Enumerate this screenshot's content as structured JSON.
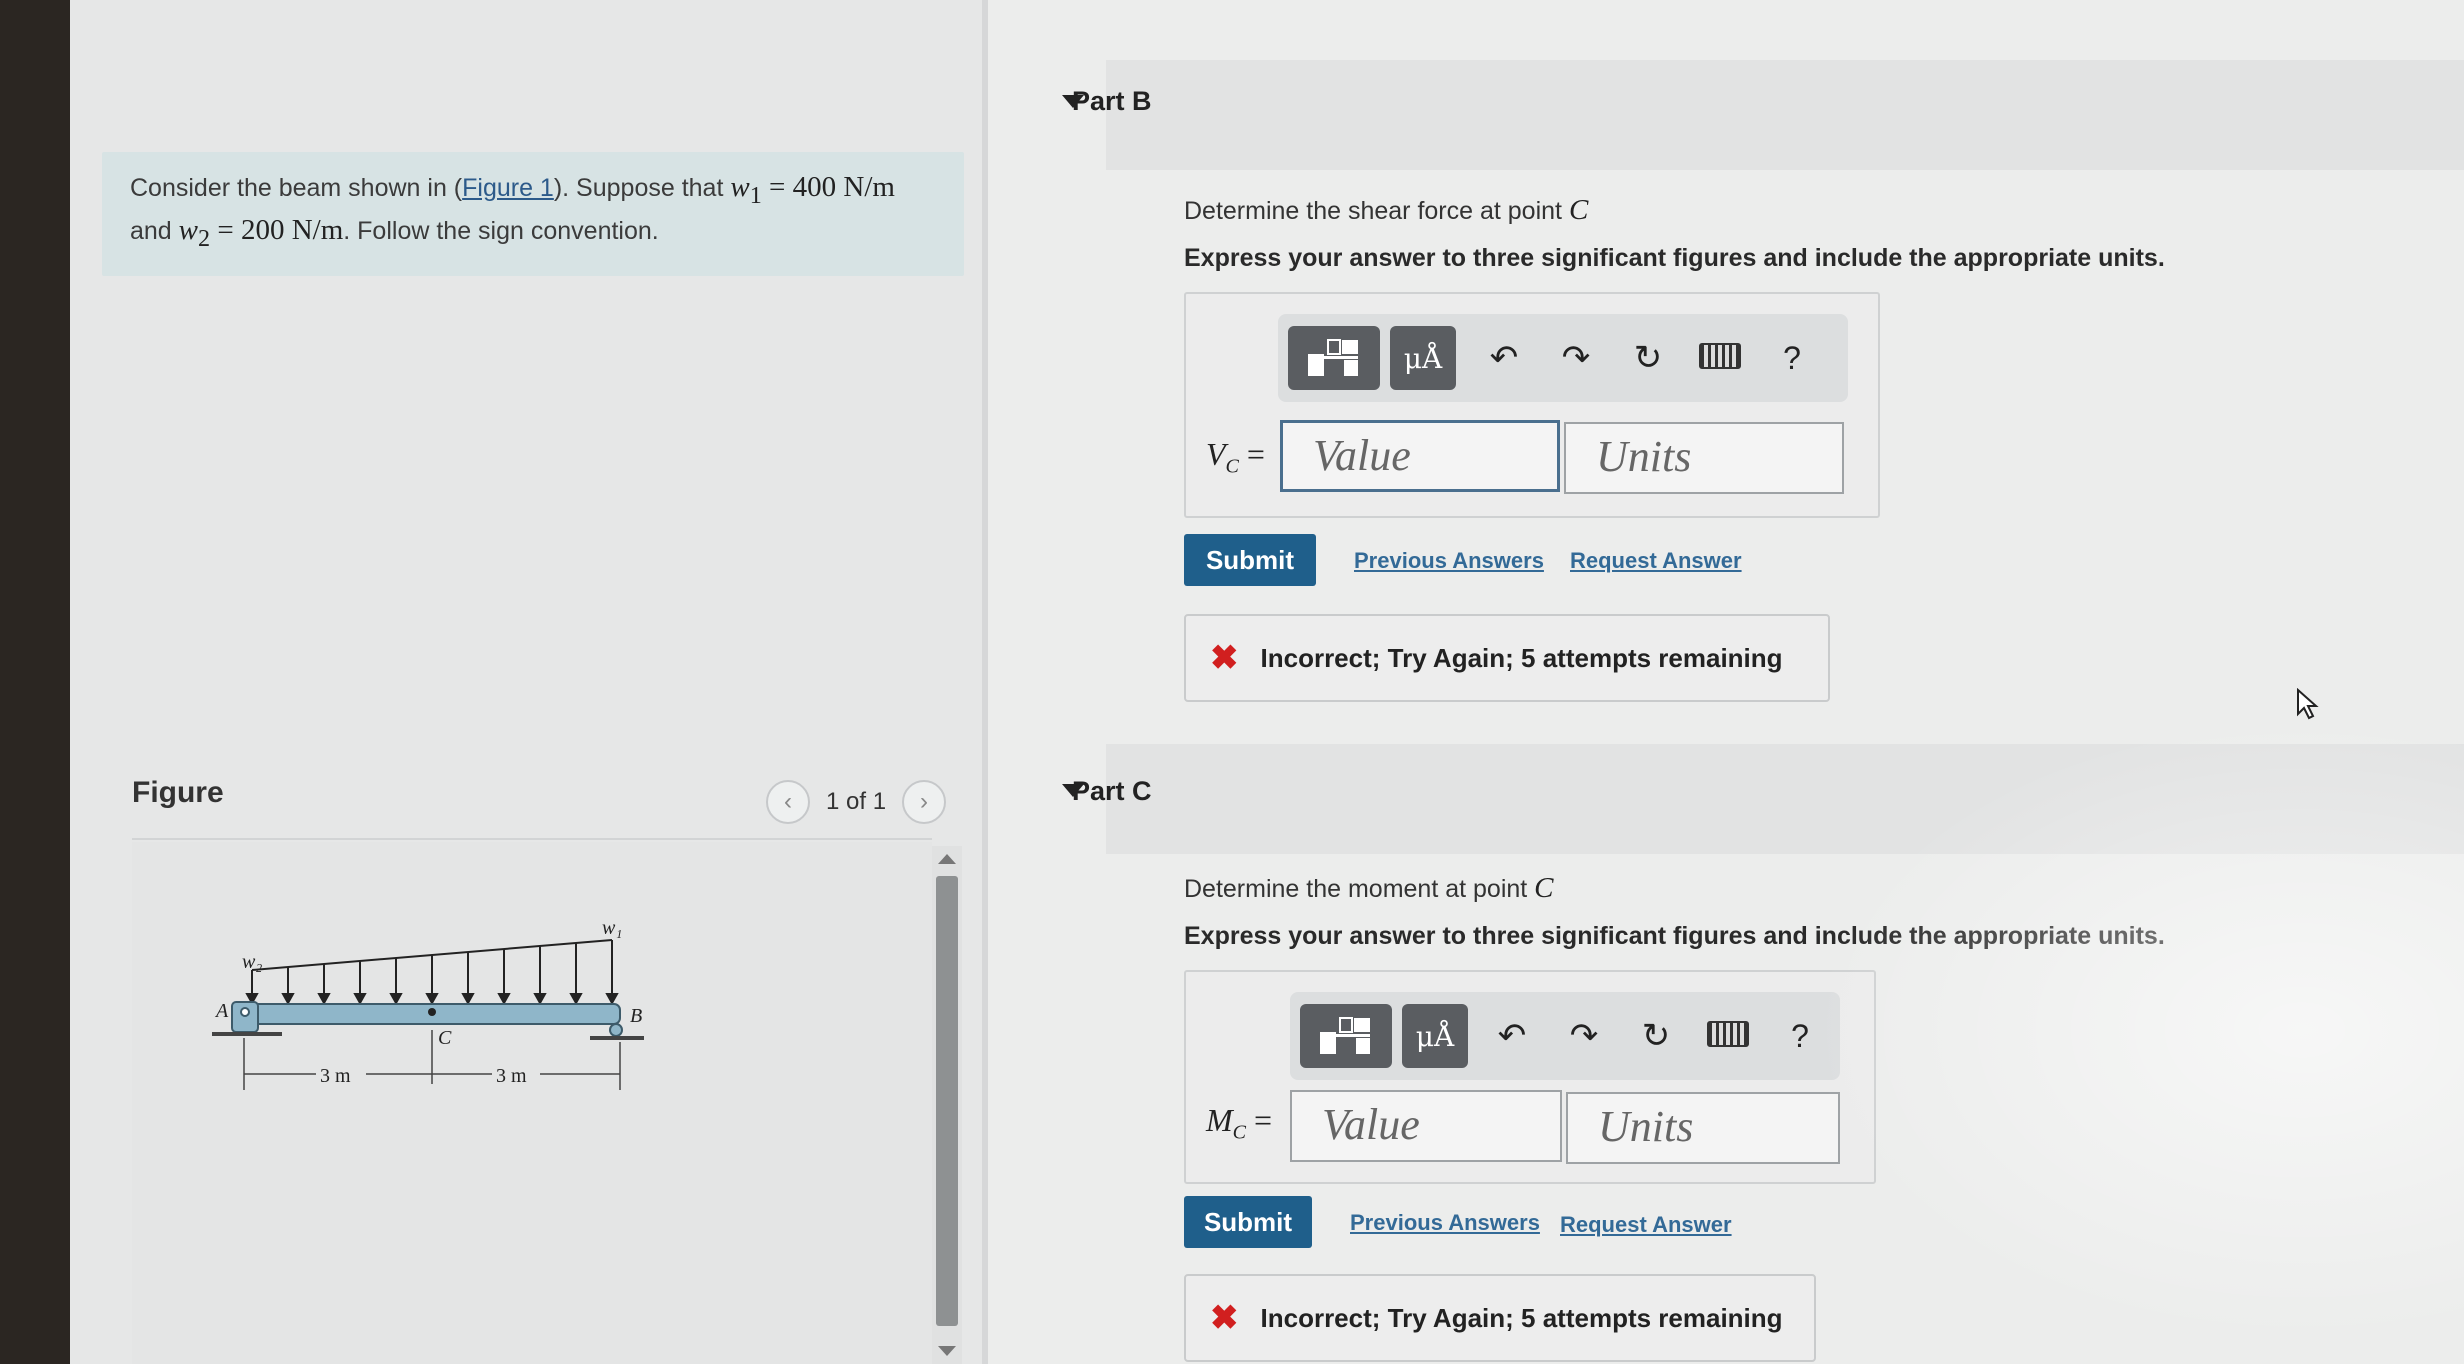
{
  "problem": {
    "text_before_link": "Consider the beam shown in (",
    "link": "Figure 1",
    "text_after_link": "). Suppose that ",
    "w1_symbol": "w",
    "w1_sub": "1",
    "w1_value": " = 400 N/m",
    "line2_start": "and ",
    "w2_symbol": "w",
    "w2_sub": "2",
    "w2_value": " = 200 N/m",
    "line2_end": ". Follow the sign convention."
  },
  "figure": {
    "title": "Figure",
    "page_indicator": "1 of 1",
    "prev_icon": "chevron-left-icon",
    "next_icon": "chevron-right-icon",
    "labels": {
      "w1": "w₁",
      "w2": "w₂",
      "a": "A",
      "b": "B",
      "c": "C",
      "dim_left": "3 m",
      "dim_right": "3 m"
    }
  },
  "parts": [
    {
      "title": "Part B",
      "prompt": "Determine the shear force at point ",
      "prompt_point": "C",
      "instruction": "Express your answer to three significant figures and include the appropriate units.",
      "label_var": "V",
      "label_sub": "C",
      "label_eq": " =",
      "value_placeholder": "Value",
      "units_placeholder": "Units",
      "submit": "Submit",
      "previous_answers": "Previous Answers",
      "request_answer": "Request Answer",
      "feedback": "Incorrect; Try Again; 5 attempts remaining"
    },
    {
      "title": "Part C",
      "prompt": "Determine the moment at point ",
      "prompt_point": "C",
      "instruction": "Express your answer to three significant figures and include the appropriate units.",
      "label_var": "M",
      "label_sub": "C",
      "label_eq": " =",
      "value_placeholder": "Value",
      "units_placeholder": "Units",
      "submit": "Submit",
      "previous_answers": "Previous Answers",
      "request_answer": "Request Answer",
      "feedback": "Incorrect; Try Again; 5 attempts remaining"
    }
  ],
  "toolbar": {
    "templates_icon": "templates-icon",
    "units_label": "μÅ",
    "undo_icon": "undo-icon",
    "redo_icon": "redo-icon",
    "reset_icon": "reset-icon",
    "keyboard_icon": "keyboard-icon",
    "help_label": "?"
  },
  "colors": {
    "submit": "#1f5f8b",
    "link": "#336a97",
    "error": "#d11f1f",
    "problem_bg": "#d7e3e4",
    "beam": "#8fb6c9"
  }
}
